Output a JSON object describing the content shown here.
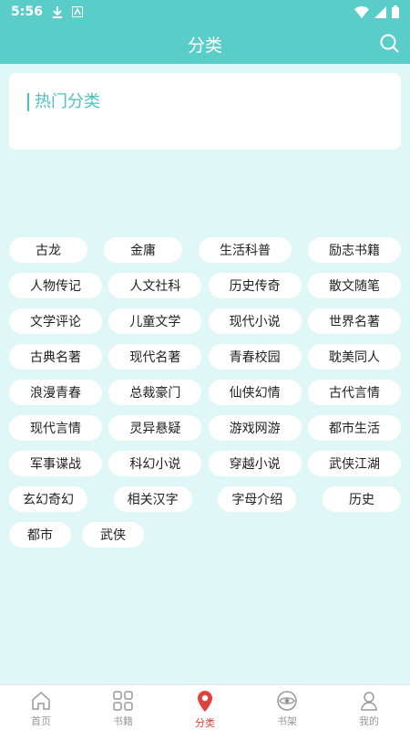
{
  "status_bar": {
    "time": "5:56"
  },
  "app_bar": {
    "title": "分类"
  },
  "hot_section": {
    "title": "热门分类"
  },
  "categories": [
    [
      "古龙",
      "金庸",
      "生活科普",
      "励志书籍"
    ],
    [
      "人物传记",
      "人文社科",
      "历史传奇",
      "散文随笔"
    ],
    [
      "文学评论",
      "儿童文学",
      "现代小说",
      "世界名著"
    ],
    [
      "古典名著",
      "现代名著",
      "青春校园",
      "耽美同人"
    ],
    [
      "浪漫青春",
      "总裁豪门",
      "仙侠幻情",
      "古代言情"
    ],
    [
      "现代言情",
      "灵异悬疑",
      "游戏网游",
      "都市生活"
    ],
    [
      "军事谍战",
      "科幻小说",
      "穿越小说",
      "武侠江湖"
    ],
    [
      "玄幻奇幻",
      "相关汉字",
      "字母介绍",
      "历史"
    ],
    [
      "都市",
      "武侠"
    ]
  ],
  "tabs": [
    {
      "label": "首页",
      "icon": "home-icon"
    },
    {
      "label": "书籍",
      "icon": "grid-icon"
    },
    {
      "label": "分类",
      "icon": "location-pin-icon",
      "active": true
    },
    {
      "label": "书架",
      "icon": "eye-icon"
    },
    {
      "label": "我的",
      "icon": "person-icon"
    }
  ],
  "colors": {
    "primary": "#5bcdc9",
    "accent": "#e0413a",
    "background": "#e0f7f7"
  }
}
